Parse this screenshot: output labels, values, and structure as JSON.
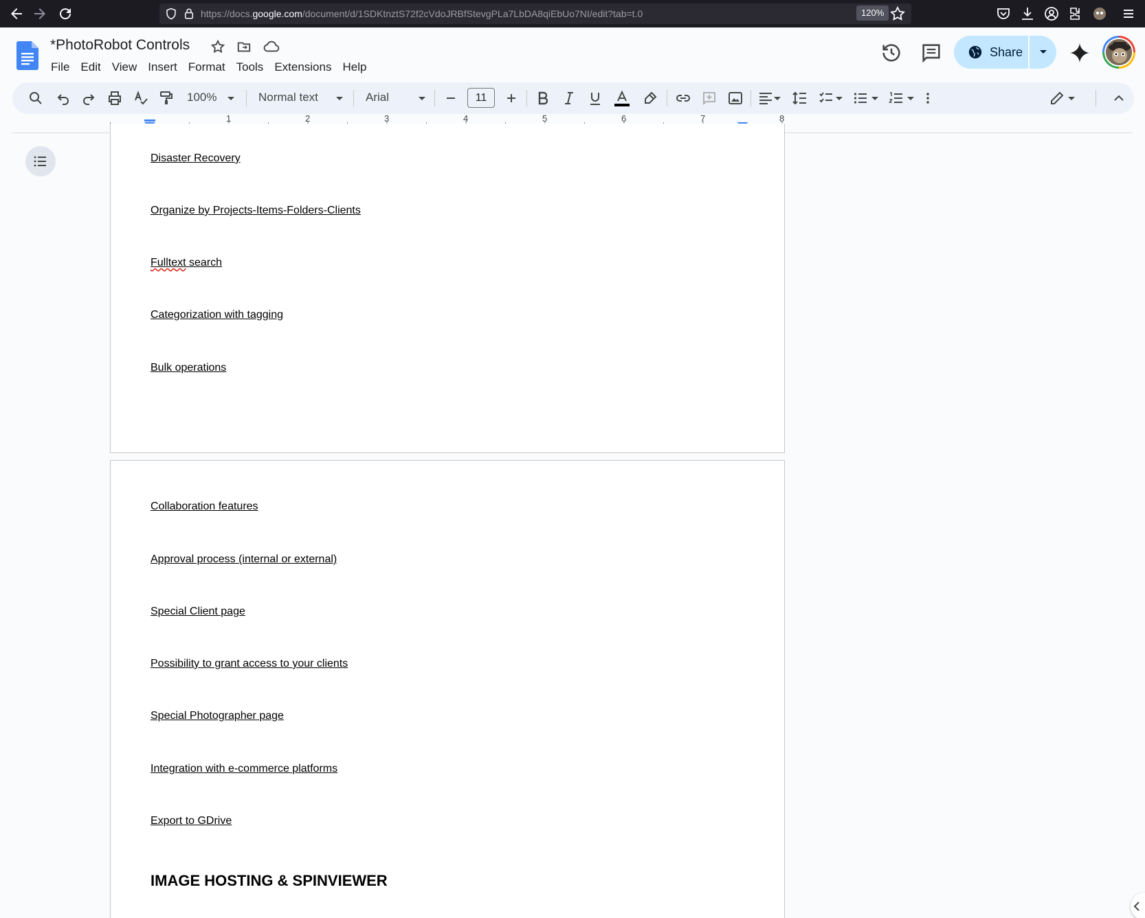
{
  "browser": {
    "url_prefix": "https://docs.",
    "url_domain": "google.com",
    "url_path": "/document/d/1SDKtnztS72f2cVdoJRBfStevgPLa7LbDA8qiEbUo7NI/edit?tab=t.0",
    "zoom": "120%",
    "icons": [
      "back-icon",
      "forward-icon",
      "reload-icon",
      "shield-icon",
      "lock-icon",
      "bookmark-star-icon",
      "pocket-icon",
      "download-icon",
      "account-icon",
      "extensions-icon",
      "profile-icon",
      "menu-icon"
    ]
  },
  "doc": {
    "title": "*PhotoRobot Controls",
    "menu": [
      "File",
      "Edit",
      "View",
      "Insert",
      "Format",
      "Tools",
      "Extensions",
      "Help"
    ],
    "share_label": "Share"
  },
  "toolbar": {
    "zoom": "100%",
    "style": "Normal text",
    "font": "Arial",
    "font_size": "11"
  },
  "ruler": {
    "labels": [
      "1",
      "2",
      "3",
      "4",
      "5",
      "6",
      "7",
      "8"
    ]
  },
  "page1": {
    "lines": [
      "Disaster Recovery",
      "Organize by Projects-Items-Folders-Clients",
      "Fulltext",
      " search",
      "Categorization with tagging",
      "Bulk operations"
    ]
  },
  "page2": {
    "lines": [
      "Collaboration features",
      "Approval process (internal or external)",
      "Special Client page",
      "Possibility to grant access to your clients",
      "Special Photographer page",
      "Integration with e-commerce platforms",
      "Export to GDrive"
    ],
    "heading": "IMAGE HOSTING & SPINVIEWER"
  },
  "colors": {
    "browser_bg": "#1c1b22",
    "docs_bg": "#f9fbfd",
    "toolbar_bg": "#edf2fa",
    "share_bg": "#c2e7ff",
    "docs_blue": "#4285f4"
  }
}
